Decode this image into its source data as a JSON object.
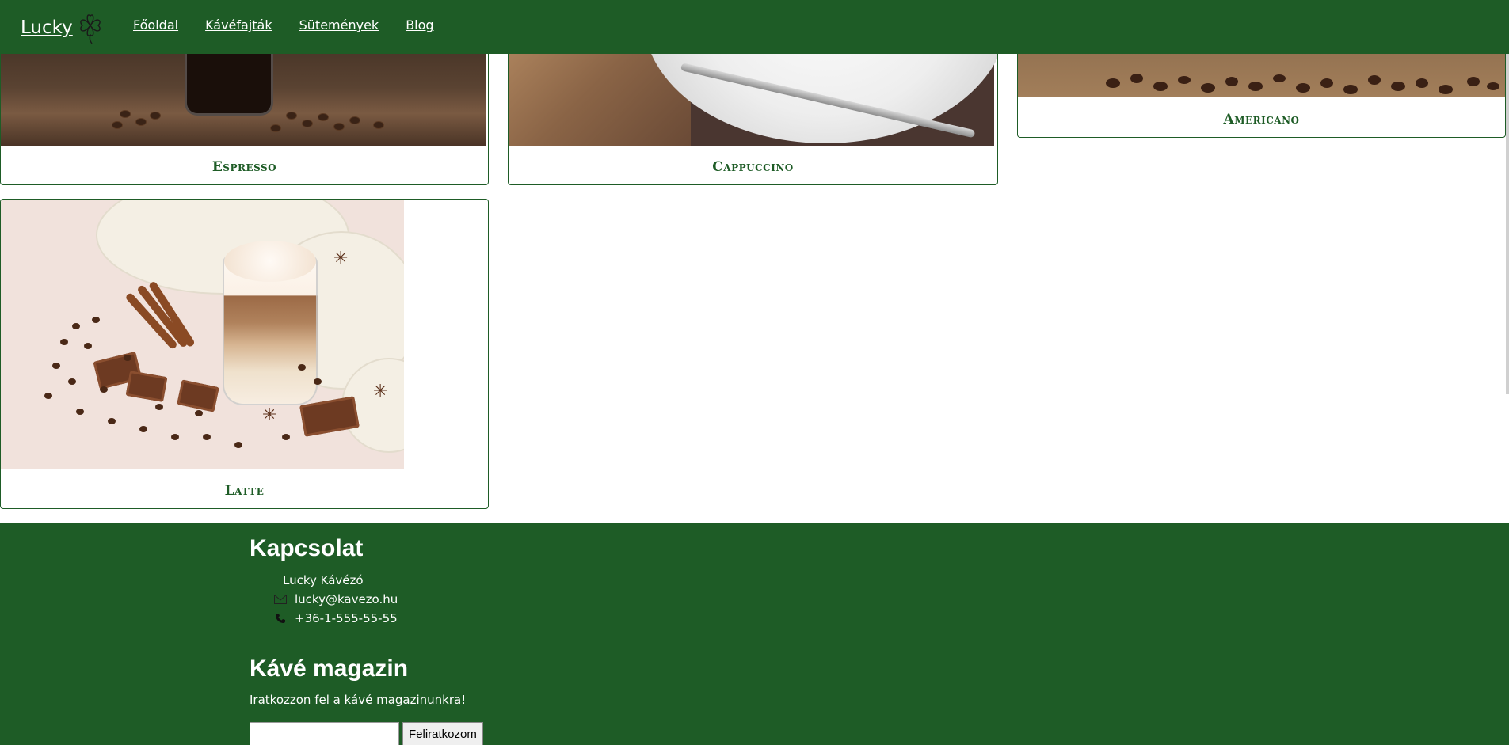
{
  "brand": {
    "name": "Lucky",
    "logo_icon": "clover-icon"
  },
  "nav": {
    "items": [
      "Főoldal",
      "Kávéfajták",
      "Sütemények",
      "Blog"
    ]
  },
  "cards": [
    {
      "title": "Espresso",
      "image": "espresso-cup-with-coffee-beans"
    },
    {
      "title": "Cappuccino",
      "image": "cappuccino-saucer-with-spoon"
    },
    {
      "title": "Americano",
      "image": "coffee-beans-on-burlap"
    },
    {
      "title": "Latte",
      "image": "latte-glass-with-chocolate-and-cinnamon"
    }
  ],
  "footer": {
    "contact": {
      "heading": "Kapcsolat",
      "name": "Lucky Kávézó",
      "email": "lucky@kavezo.hu",
      "phone": "+36-1-555-55-55",
      "email_icon": "envelope-icon",
      "phone_icon": "phone-icon"
    },
    "newsletter": {
      "heading": "Kávé magazin",
      "text": "Iratkozzon fel a kávé magazinunkra!",
      "input_value": "",
      "button_label": "Feliratkozom"
    }
  },
  "colors": {
    "brand_green": "#1e5c26",
    "white": "#ffffff"
  }
}
